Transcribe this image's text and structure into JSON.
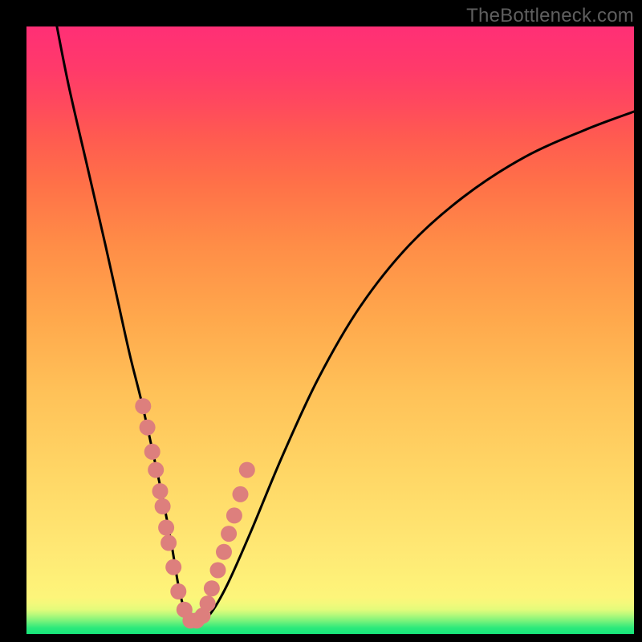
{
  "watermark": "TheBottleneck.com",
  "colors": {
    "frame": "#000000",
    "curve": "#000000",
    "dot": "#dd7f7d"
  },
  "chart_data": {
    "type": "line",
    "title": "",
    "xlabel": "",
    "ylabel": "",
    "xlim": [
      0,
      100
    ],
    "ylim": [
      0,
      100
    ],
    "series": [
      {
        "name": "bottleneck-curve",
        "x": [
          5,
          7,
          10,
          13,
          15,
          17,
          19,
          21,
          22.5,
          24,
          25,
          26,
          27,
          28,
          30,
          33,
          37,
          42,
          48,
          55,
          63,
          72,
          82,
          92,
          100
        ],
        "y": [
          100,
          90,
          77,
          64,
          55,
          46,
          38,
          29,
          22,
          14,
          8,
          4,
          2.2,
          2.2,
          3,
          8,
          17,
          29,
          42,
          54,
          64,
          72,
          78.5,
          83,
          86
        ]
      }
    ],
    "markers": {
      "name": "highlighted-points",
      "x": [
        19.2,
        19.9,
        20.7,
        21.3,
        22.0,
        22.4,
        23.0,
        23.4,
        24.2,
        25.0,
        26.0,
        27.0,
        28.0,
        29.0,
        29.8,
        30.5,
        31.5,
        32.5,
        33.3,
        34.2,
        35.2,
        36.3
      ],
      "y": [
        37.5,
        34.0,
        30.0,
        27.0,
        23.5,
        21.0,
        17.5,
        15.0,
        11.0,
        7.0,
        4.0,
        2.2,
        2.2,
        3.0,
        5.0,
        7.5,
        10.5,
        13.5,
        16.5,
        19.5,
        23.0,
        27.0
      ]
    }
  }
}
